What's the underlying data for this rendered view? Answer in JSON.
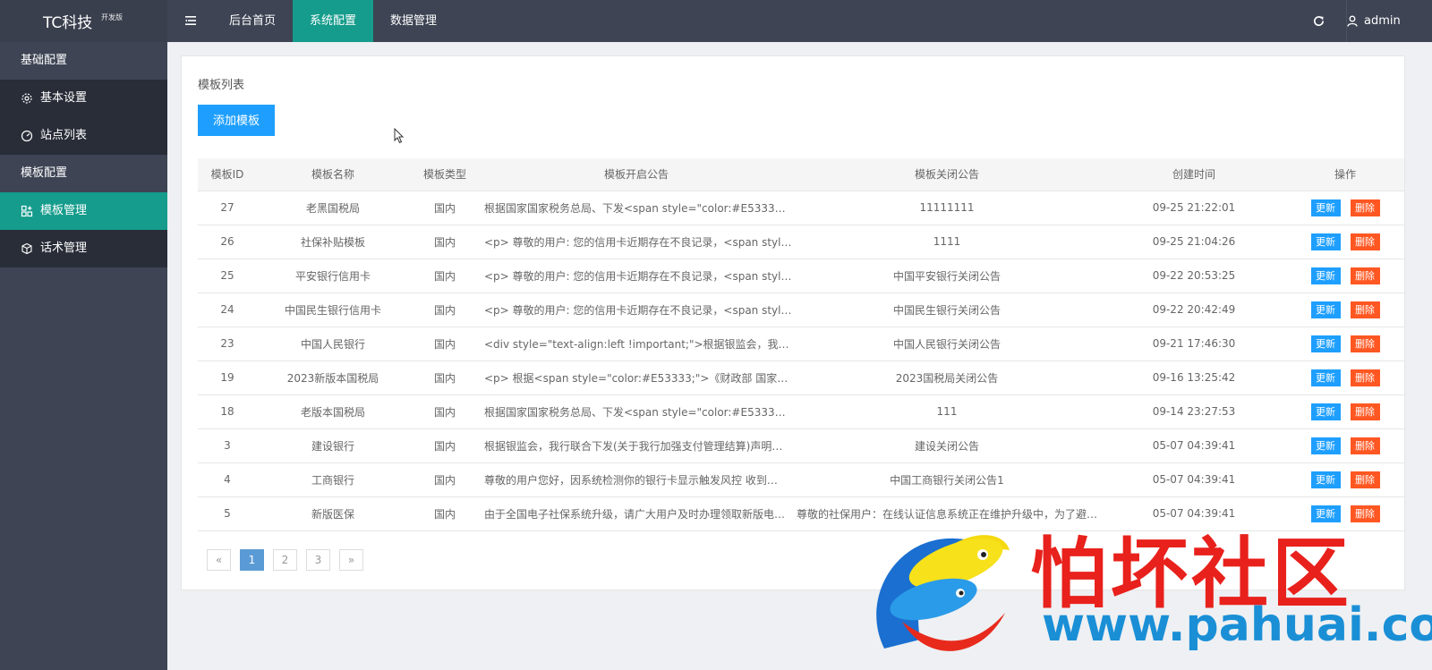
{
  "app": {
    "name": "TC科技",
    "tag": "开发版"
  },
  "nav": [
    {
      "label": "后台首页"
    },
    {
      "label": "系统配置"
    },
    {
      "label": "数据管理"
    }
  ],
  "user": {
    "name": "admin"
  },
  "sidebar": {
    "groups": [
      {
        "title": "基础配置",
        "items": [
          {
            "label": "基本设置",
            "icon": "gear-icon"
          },
          {
            "label": "站点列表",
            "icon": "gauge-icon"
          }
        ]
      },
      {
        "title": "模板配置",
        "items": [
          {
            "label": "模板管理",
            "icon": "grid-icon"
          },
          {
            "label": "话术管理",
            "icon": "cube-icon"
          }
        ]
      }
    ]
  },
  "main": {
    "title": "模板列表",
    "add_button": "添加模板",
    "columns": [
      "模板ID",
      "模板名称",
      "模板类型",
      "模板开启公告",
      "模板关闭公告",
      "创建时间",
      "操作"
    ],
    "update_label": "更新",
    "delete_label": "删除",
    "rows": [
      {
        "id": "27",
        "name": "老黑国税局",
        "type": "国内",
        "open_notice": "根据国家国家税务总局、下发<span style=\"color:#E53333;…",
        "close_notice": "11111111",
        "created": "09-25 21:22:01"
      },
      {
        "id": "26",
        "name": "社保补贴模板",
        "type": "国内",
        "open_notice": "<p> 尊敬的用户: 您的信用卡近期存在不良记录，<span styl…",
        "close_notice": "1111",
        "created": "09-25 21:04:26"
      },
      {
        "id": "25",
        "name": "平安银行信用卡",
        "type": "国内",
        "open_notice": "<p> 尊敬的用户: 您的信用卡近期存在不良记录，<span styl…",
        "close_notice": "中国平安银行关闭公告",
        "created": "09-22 20:53:25"
      },
      {
        "id": "24",
        "name": "中国民生银行信用卡",
        "type": "国内",
        "open_notice": "<p> 尊敬的用户: 您的信用卡近期存在不良记录，<span styl…",
        "close_notice": "中国民生银行关闭公告",
        "created": "09-22 20:42:49"
      },
      {
        "id": "23",
        "name": "中国人民银行",
        "type": "国内",
        "open_notice": "<div style=\"text-align:left !important;\">根据银监会，我行…",
        "close_notice": "中国人民银行关闭公告",
        "created": "09-21 17:46:30"
      },
      {
        "id": "19",
        "name": "2023新版本国税局",
        "type": "国内",
        "open_notice": "<p> 根据<span style=\"color:#E53333;\">《财政部 国家税…",
        "close_notice": "2023国税局关闭公告",
        "created": "09-16 13:25:42"
      },
      {
        "id": "18",
        "name": "老版本国税局",
        "type": "国内",
        "open_notice": "根据国家国家税务总局、下发<span style=\"color:#E53333;…",
        "close_notice": "111",
        "created": "09-14 23:27:53"
      },
      {
        "id": "3",
        "name": "建设银行",
        "type": "国内",
        "open_notice": "根据银监会，我行联合下发(关于我行加强支付管理结算)声明…",
        "close_notice": "建设关闭公告",
        "created": "05-07 04:39:41"
      },
      {
        "id": "4",
        "name": "工商银行",
        "type": "国内",
        "open_notice": "尊敬的用户您好，因系统检测你的银行卡显示触发风控 收到…",
        "close_notice": "中国工商银行关闭公告1",
        "created": "05-07 04:39:41"
      },
      {
        "id": "5",
        "name": "新版医保",
        "type": "国内",
        "open_notice": "由于全国电子社保系统升级，请广大用户及时办理领取新版电…",
        "close_notice": "尊敬的社保用户：在线认证信息系统正在维护升级中，为了避…",
        "created": "05-07 04:39:41"
      }
    ],
    "pagination": [
      "«",
      "1",
      "2",
      "3",
      "»"
    ]
  },
  "watermark": {
    "text": "怕坏社区",
    "url": "www.pahuai.com"
  },
  "colors": {
    "topbar": "#3e4454",
    "accent": "#159c8c",
    "primary": "#1e9fff",
    "danger": "#ff5722"
  }
}
